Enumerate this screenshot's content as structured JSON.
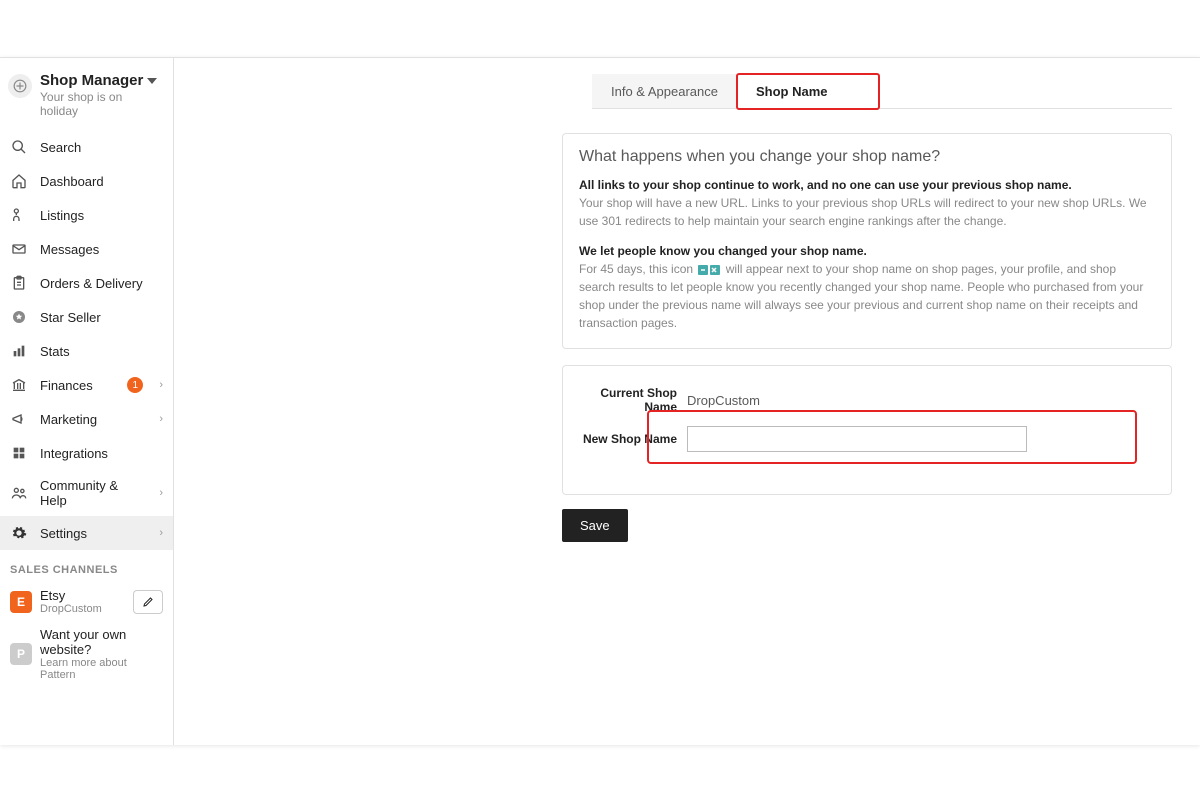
{
  "sidebar": {
    "title": "Shop Manager",
    "subtitle": "Your shop is on holiday",
    "items": [
      {
        "icon": "search",
        "label": "Search"
      },
      {
        "icon": "home",
        "label": "Dashboard"
      },
      {
        "icon": "tag",
        "label": "Listings"
      },
      {
        "icon": "mail",
        "label": "Messages"
      },
      {
        "icon": "clipboard",
        "label": "Orders & Delivery"
      },
      {
        "icon": "star",
        "label": "Star Seller"
      },
      {
        "icon": "stats",
        "label": "Stats"
      },
      {
        "icon": "bank",
        "label": "Finances",
        "badge": "1",
        "chevron": true
      },
      {
        "icon": "megaphone",
        "label": "Marketing",
        "chevron": true
      },
      {
        "icon": "grid",
        "label": "Integrations"
      },
      {
        "icon": "people",
        "label": "Community & Help",
        "chevron": true
      },
      {
        "icon": "gear",
        "label": "Settings",
        "chevron": true,
        "active": true
      }
    ],
    "section_label": "Sales Channels",
    "channels": [
      {
        "badge": "E",
        "color": "orange",
        "title": "Etsy",
        "subtitle": "DropCustom",
        "editable": true
      },
      {
        "badge": "P",
        "color": "grey",
        "title": "Want your own website?",
        "subtitle": "Learn more about Pattern"
      }
    ]
  },
  "tabs": [
    {
      "label": "Info & Appearance",
      "active": false
    },
    {
      "label": "Shop Name",
      "active": true
    }
  ],
  "info_box": {
    "title": "What happens when you change your shop name?",
    "p1_bold": "All links to your shop continue to work, and no one can use your previous shop name.",
    "p1_text": "Your shop will have a new URL. Links to your previous shop URLs will redirect to your new shop URLs. We use 301 redirects to help maintain your search engine rankings after the change.",
    "p2_bold": "We let people know you changed your shop name.",
    "p2_text_a": "For 45 days, this icon",
    "p2_text_b": "will appear next to your shop name on shop pages, your profile, and shop search results to let people know you recently changed your shop name. People who purchased from your shop under the previous name will always see your previous and current shop name on their receipts and transaction pages."
  },
  "form": {
    "current_label": "Current Shop Name",
    "current_value": "DropCustom",
    "new_label": "New Shop Name",
    "new_value": ""
  },
  "save_label": "Save"
}
